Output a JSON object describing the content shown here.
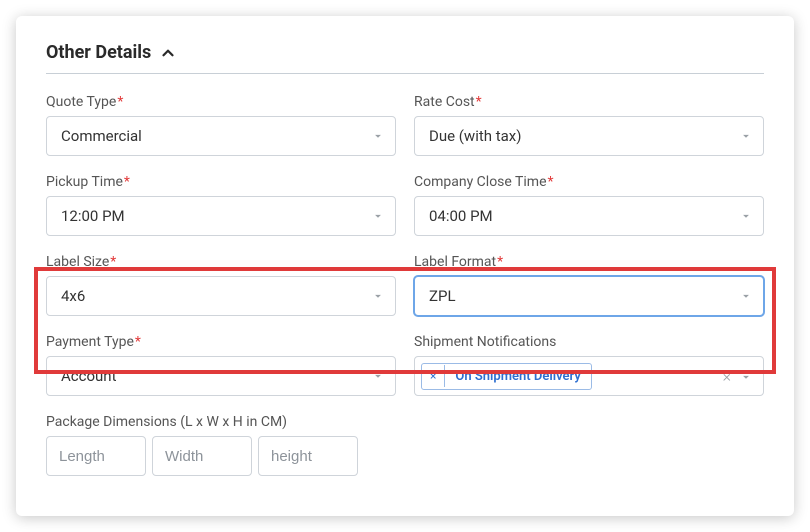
{
  "section": {
    "title": "Other Details"
  },
  "required_mark": "*",
  "fields": {
    "quote_type": {
      "label": "Quote Type",
      "value": "Commercial"
    },
    "rate_cost": {
      "label": "Rate Cost",
      "value": "Due (with tax)"
    },
    "pickup_time": {
      "label": "Pickup Time",
      "value": "12:00 PM"
    },
    "close_time": {
      "label": "Company Close Time",
      "value": "04:00 PM"
    },
    "label_size": {
      "label": "Label Size",
      "value": "4x6"
    },
    "label_format": {
      "label": "Label Format",
      "value": "ZPL"
    },
    "payment_type": {
      "label": "Payment Type",
      "value": "Account"
    },
    "ship_notif": {
      "label": "Shipment Notifications",
      "tag_text": "On Shipment Delivery",
      "tag_remove": "×",
      "clear": "×"
    },
    "dimensions": {
      "label": "Package Dimensions (L x W x H in CM)",
      "length_ph": "Length",
      "width_ph": "Width",
      "height_ph": "height"
    }
  }
}
